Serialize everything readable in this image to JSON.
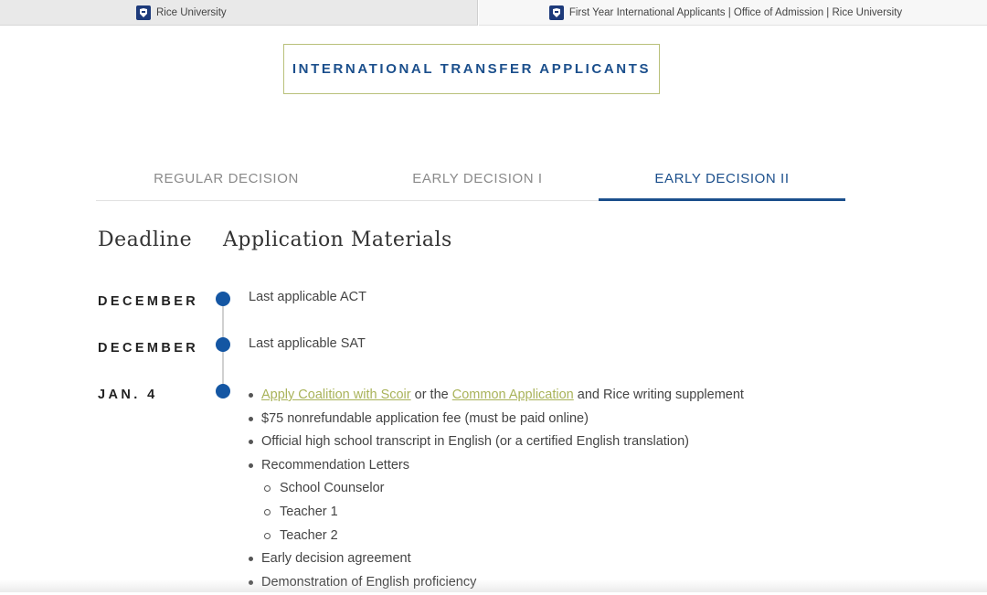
{
  "browser": {
    "tabs": [
      {
        "title": "Rice University"
      },
      {
        "title": "First Year International Applicants | Office of Admission | Rice University"
      }
    ]
  },
  "page": {
    "heading": "INTERNATIONAL TRANSFER APPLICANTS",
    "decision_tabs": [
      "REGULAR DECISION",
      "EARLY DECISION I",
      "EARLY DECISION II"
    ],
    "active_tab": "EARLY DECISION II",
    "columns": {
      "deadline": "Deadline",
      "materials": "Application Materials"
    },
    "timeline": [
      {
        "date": "DECEMBER",
        "text": "Last applicable ACT"
      },
      {
        "date": "DECEMBER",
        "text": "Last applicable SAT"
      },
      {
        "date": "JAN. 4"
      }
    ],
    "materials": {
      "item1": {
        "link1": "Apply Coalition with Scoir",
        "mid": "or the",
        "link2": "Common Application",
        "tail": "and Rice writing supplement"
      },
      "item2": "$75 nonrefundable application fee (must be paid online)",
      "item3": "Official high school transcript in English (or a certified English translation)",
      "item4": "Recommendation Letters",
      "sub": [
        "School Counselor",
        "Teacher 1",
        "Teacher 2"
      ],
      "item5": "Early decision agreement",
      "item6": "Demonstration of English proficiency"
    }
  },
  "colors": {
    "accent": "#1b4f8c",
    "dot": "#1456a3",
    "link": "#a9b35a",
    "border": "#b9c07a"
  }
}
